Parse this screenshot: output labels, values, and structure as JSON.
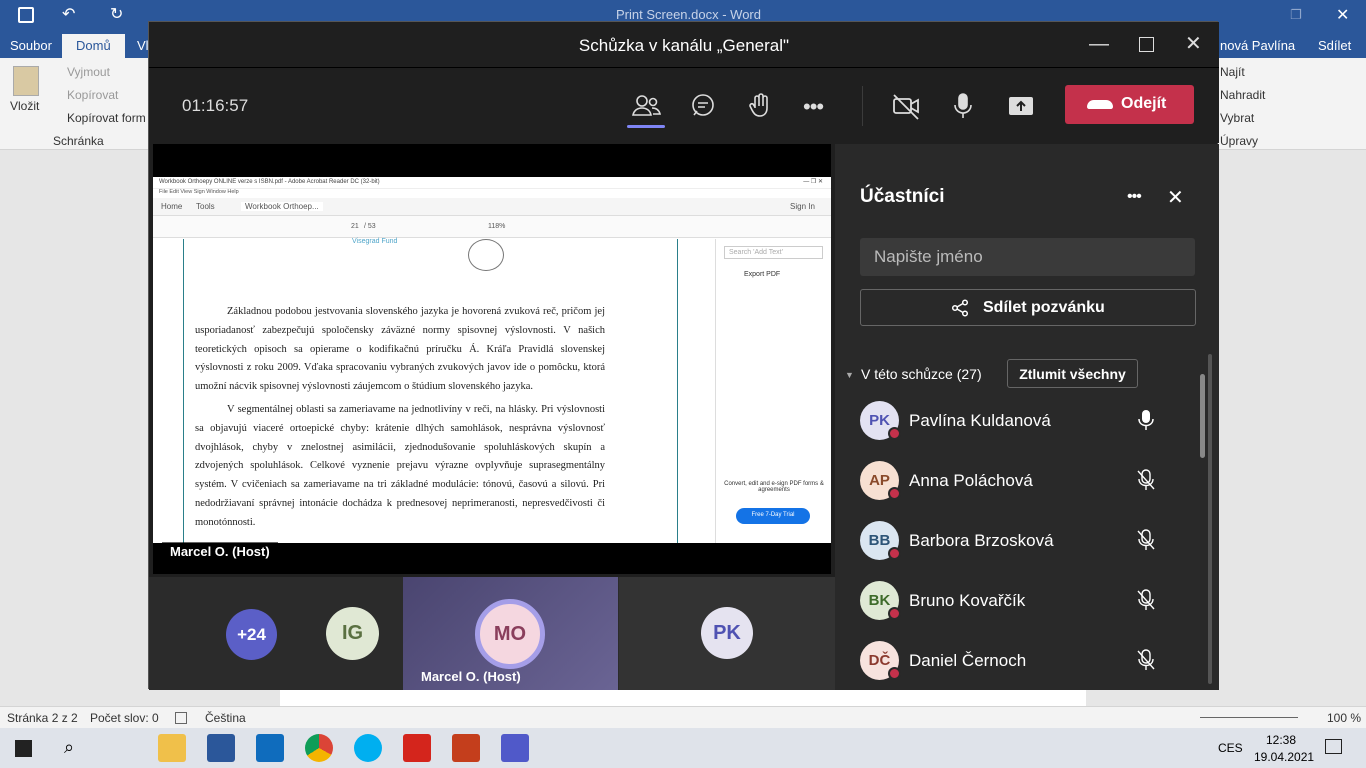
{
  "word": {
    "window_title": "Print Screen.docx - Word",
    "tabs": {
      "file": "Soubor",
      "home": "Domů",
      "view_partial": "Vl"
    },
    "user": "nová Pavlína",
    "share": "Sdílet",
    "ribbon": {
      "paste": "Vložit",
      "cut": "Vyjmout",
      "copy": "Kopírovat",
      "format_painter": "Kopírovat form",
      "clipboard_group": "Schránka",
      "find": "Najít",
      "replace": "Nahradit",
      "select": "Vybrat",
      "editing_group": "Úpravy"
    },
    "status": {
      "page": "Stránka 2 z 2",
      "words": "Počet slov: 0",
      "language": "Čeština",
      "zoom": "100 %"
    }
  },
  "taskbar": {
    "language": "CES",
    "time": "12:38",
    "date": "19.04.2021"
  },
  "teams": {
    "window_title": "Schůzka v kanálu „General\"",
    "timer": "01:16:57",
    "leave_label": "Odejít",
    "shared_screen": {
      "presenter_label": "Marcel O. (Host)",
      "pdf": {
        "window_title": "Workbook Orthoepy ONLINE verze s ISBN.pdf - Adobe Acrobat Reader DC (32-bit)",
        "menu": "File  Edit  View  Sign  Window  Help",
        "tabs": [
          "Home",
          "Tools",
          "Workbook Orthoep..."
        ],
        "sign_in": "Sign In",
        "page_num": "21",
        "page_total": "/ 53",
        "zoom": "118%",
        "header_text": "Visegrad Fund",
        "search_placeholder": "Search 'Add Text'",
        "export_pdf": "Export PDF",
        "promo": "Convert, edit and e-sign PDF forms & agreements",
        "trial_button": "Free 7-Day Trial",
        "paragraph1": "Základnou podobou jestvovania slovenského jazyka je hovorená zvuková reč, pričom jej usporiadanosť zabezpečujú spoločensky záväzné normy spisovnej výslovnosti. V našich teoretických opisoch sa opierame o kodifikačnú príručku Á. Kráľa Pravidlá slovenskej výslovnosti z roku 2009. Vďaka spracovaniu vybraných zvukových javov ide o pomôcku, ktorá umožní nácvik spisovnej výslovnosti záujemcom o štúdium slovenského jazyka.",
        "paragraph2": "V segmentálnej oblasti sa zameriavame na jednotlivíny v reči, na hlásky. Pri výslovnosti sa objavujú viaceré ortoepické chyby: krátenie dlhých samohlások, nesprávna výslovnosť dvojhlások, chyby v znelostnej asimilácii, zjednodušovanie spoluhláskových skupín a zdvojených spoluhlások. Celkové vyznenie prejavu výrazne ovplyvňuje suprasegmentálny systém. V cvičeniach sa zameriavame na tri základné modulácie: tónovú, časovú a silovú. Pri nedodržiavaní správnej intonácie dochádza k prednesovej neprimeranosti, nepresvedčivosti či monotónnosti."
      }
    },
    "tiles": [
      {
        "initials": "+24",
        "color": "#5b5fc7"
      },
      {
        "initials": "IG",
        "color": "#e0e8d4"
      },
      {
        "initials": "MO",
        "label": "Marcel O. (Host)",
        "color": "#f5d7e0"
      },
      {
        "initials": "PK",
        "color": "#e5e3f0"
      }
    ],
    "panel": {
      "title": "Účastníci",
      "search_placeholder": "Napište jméno",
      "invite_label": "Sdílet pozvánku",
      "section_label": "V této schůzce (27)",
      "mute_all_label": "Ztlumit všechny",
      "participants": [
        {
          "initials": "PK",
          "name": "Pavlína Kuldanová",
          "mic": "on",
          "color": "#e3e2f2",
          "text_color": "#4f52b2"
        },
        {
          "initials": "AP",
          "name": "Anna Poláchová",
          "mic": "muted",
          "color": "#f7e0d2",
          "text_color": "#8a4a2a"
        },
        {
          "initials": "BB",
          "name": "Barbora Brzosková",
          "mic": "muted",
          "color": "#dbe6f1",
          "text_color": "#2d5477"
        },
        {
          "initials": "BK",
          "name": "Bruno Kovařčík",
          "mic": "muted",
          "color": "#dfe9d5",
          "text_color": "#3d6b2a"
        },
        {
          "initials": "DČ",
          "name": "Daniel Černoch",
          "mic": "muted",
          "color": "#f7e3de",
          "text_color": "#8b3a2e"
        }
      ]
    }
  }
}
